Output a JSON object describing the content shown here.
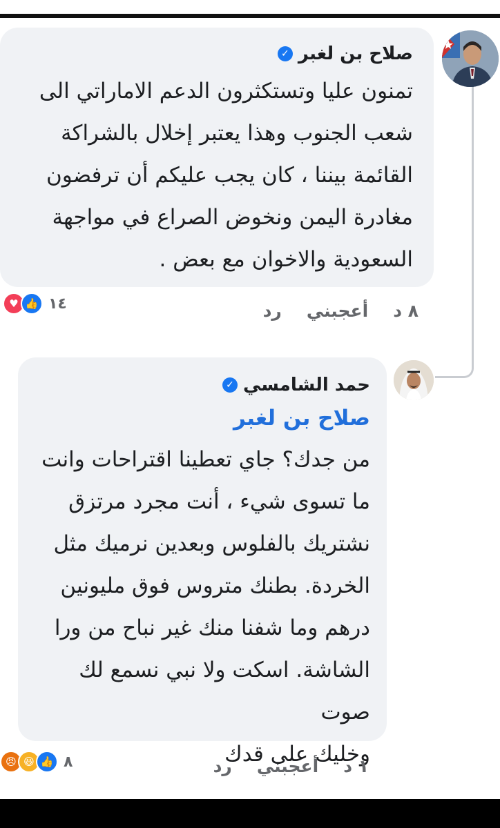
{
  "comments": [
    {
      "author": "صلاح بن لغبر",
      "verified": true,
      "text": "تمنون عليا وتستكثرون الدعم الاماراتي الى\nشعب الجنوب وهذا يعتبر إخلال بالشراكة\nالقائمة بيننا ، كان يجب عليكم أن ترفضون\nمغادرة اليمن ونخوض الصراع في مواجهة\nالسعودية والاخوان مع بعض .",
      "time": "٨ د",
      "like_label": "أعجبني",
      "reply_label": "رد",
      "reaction_count": "١٤",
      "reactions": [
        "like-icon",
        "love-icon"
      ]
    },
    {
      "author": "حمد الشامسي",
      "verified": true,
      "mention": "صلاح بن لغبر",
      "text": "من جدك؟ جاي تعطينا اقتراحات وانت\nما تسوى شيء ، أنت مجرد مرتزق\nنشتريك بالفلوس وبعدين نرميك مثل\nالخردة. بطنك متروس فوق مليونين\nدرهم وما شفنا منك غير نباح من ورا\nالشاشة. اسكت ولا نبي نسمع لك صوت\nوخليك على قدك",
      "time": "١ د",
      "like_label": "أعجبني",
      "reply_label": "رد",
      "reaction_count": "٨",
      "reactions": [
        "like-icon",
        "haha-icon",
        "angry-icon"
      ]
    }
  ],
  "colors": {
    "bubble": "#f0f2f5",
    "verified": "#1877f2",
    "mention": "#216fdb",
    "meta": "#65676b"
  }
}
